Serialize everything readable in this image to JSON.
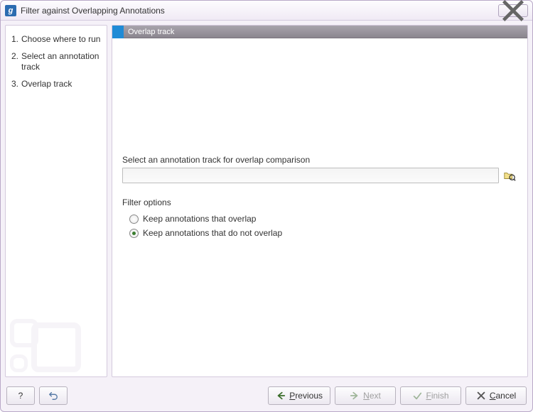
{
  "window": {
    "title": "Filter against Overlapping Annotations",
    "app_glyph": "g"
  },
  "sidebar": {
    "steps": [
      {
        "num": "1.",
        "label": "Choose where to run"
      },
      {
        "num": "2.",
        "label": "Select an annotation track"
      },
      {
        "num": "3.",
        "label": "Overlap track"
      }
    ]
  },
  "panel": {
    "title": "Overlap track",
    "select_label": "Select an annotation track for overlap comparison",
    "track_value": "",
    "filter_section": "Filter options",
    "radios": [
      {
        "label": "Keep annotations that overlap",
        "selected": false
      },
      {
        "label": "Keep annotations that do not overlap",
        "selected": true
      }
    ]
  },
  "footer": {
    "help": "?",
    "previous": "Previous",
    "next": "Next",
    "finish": "Finish",
    "cancel": "Cancel"
  }
}
